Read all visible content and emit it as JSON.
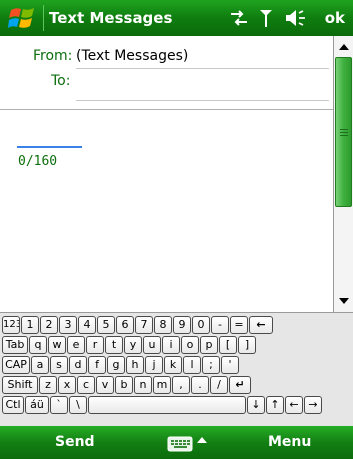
{
  "titlebar": {
    "title": "Text Messages",
    "ok_label": "ok",
    "icons": [
      "windows-start-icon",
      "data-connection-icon",
      "signal-icon",
      "volume-icon"
    ]
  },
  "header": {
    "from_label": "From:",
    "from_value": "(Text Messages)",
    "to_label": "To:",
    "to_value": ""
  },
  "body": {
    "char_count": "0/160"
  },
  "keyboard": {
    "rows": [
      [
        "123",
        "1",
        "2",
        "3",
        "4",
        "5",
        "6",
        "7",
        "8",
        "9",
        "0",
        "-",
        "=",
        "←"
      ],
      [
        "Tab",
        "q",
        "w",
        "e",
        "r",
        "t",
        "y",
        "u",
        "i",
        "o",
        "p",
        "[",
        "]"
      ],
      [
        "CAP",
        "a",
        "s",
        "d",
        "f",
        "g",
        "h",
        "j",
        "k",
        "l",
        ";",
        "'"
      ],
      [
        "Shift",
        "z",
        "x",
        "c",
        "v",
        "b",
        "n",
        "m",
        ",",
        ".",
        "/",
        "↵"
      ],
      [
        "Ctl",
        "áü",
        "`",
        "\\",
        "",
        "↓",
        "↑",
        "←",
        "→"
      ]
    ]
  },
  "menubar": {
    "left_label": "Send",
    "right_label": "Menu"
  },
  "colors": {
    "bar_green": "#0f7d0f",
    "label_green": "#0d6e0d",
    "accent_blue": "#3a82e8"
  }
}
